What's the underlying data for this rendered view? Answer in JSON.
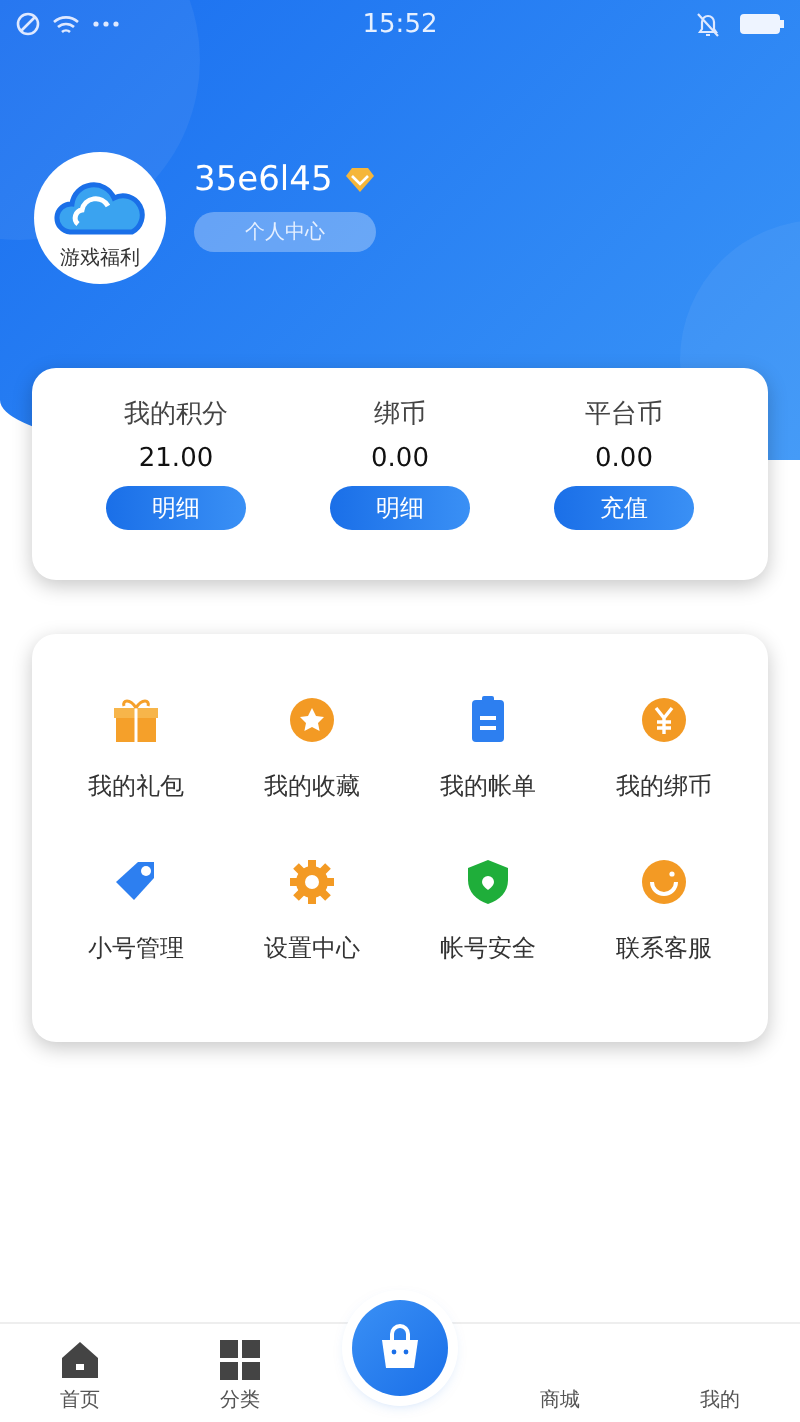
{
  "status_bar": {
    "time": "15:52"
  },
  "profile": {
    "avatar_label": "游戏福利",
    "username": "35e6l45",
    "center_button": "个人中心"
  },
  "balances": [
    {
      "label": "我的积分",
      "value": "21.00",
      "button": "明细"
    },
    {
      "label": "绑币",
      "value": "0.00",
      "button": "明细"
    },
    {
      "label": "平台币",
      "value": "0.00",
      "button": "充值"
    }
  ],
  "menu": [
    {
      "label": "我的礼包",
      "kind": "gift"
    },
    {
      "label": "我的收藏",
      "kind": "star"
    },
    {
      "label": "我的帐单",
      "kind": "bill"
    },
    {
      "label": "我的绑币",
      "kind": "yen"
    },
    {
      "label": "小号管理",
      "kind": "tag"
    },
    {
      "label": "设置中心",
      "kind": "gear"
    },
    {
      "label": "帐号安全",
      "kind": "shield"
    },
    {
      "label": "联系客服",
      "kind": "smile"
    }
  ],
  "nav": [
    {
      "label": "首页",
      "kind": "home",
      "selected": false
    },
    {
      "label": "分类",
      "kind": "grid",
      "selected": false
    },
    {
      "kind": "shop",
      "selected": false
    },
    {
      "label": "商城",
      "kind": "plain",
      "selected": false
    },
    {
      "label": "我的",
      "kind": "plain",
      "selected": false
    }
  ]
}
